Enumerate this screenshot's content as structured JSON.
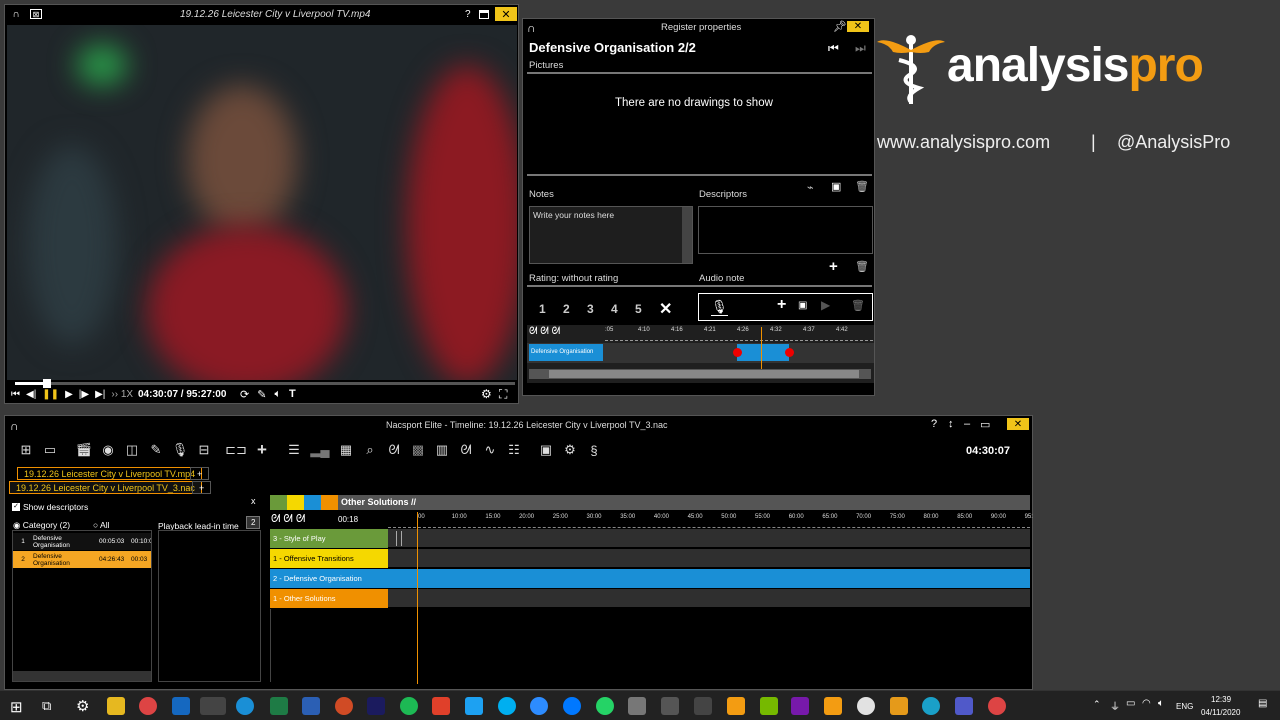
{
  "video_window": {
    "title": "19.12.26 Leicester City v Liverpool TV.mp4",
    "speed": "1X",
    "time": "04:30:07 / 95:27:00"
  },
  "register": {
    "window_title": "Register properties",
    "heading": "Defensive Organisation 2/2",
    "pictures_label": "Pictures",
    "no_drawings": "There are no drawings to show",
    "notes_label": "Notes",
    "notes_placeholder": "Write your notes here",
    "descriptors_label": "Descriptors",
    "rating_label": "Rating: without rating",
    "audio_label": "Audio note",
    "ratings": [
      "1",
      "2",
      "3",
      "4",
      "5"
    ],
    "mini_ticks": [
      ":05",
      "4:10",
      "4:16",
      "4:21",
      "4:26",
      "4:32",
      "4:37",
      "4:42"
    ],
    "mini_clip": "Defensive Organisation"
  },
  "brand": {
    "name_a": "analysis",
    "name_b": "pro",
    "website": "www.analysispro.com",
    "divider": "|",
    "handle": "@AnalysisPro",
    "accent": "#f39c12"
  },
  "timeline": {
    "title": "Nacsport Elite - Timeline: 19.12.26 Leicester City v Liverpool TV_3.nac",
    "clock": "04:30:07",
    "tab_video": "19.12.26 Leicester City v Liverpool TV.mp4",
    "tab_nac": "19.12.26 Leicester City v Liverpool TV_3.nac",
    "tab_add": "+",
    "close_x": "x",
    "show_descriptors": "Show descriptors",
    "category_label": "Category (2)",
    "all_label": "All",
    "playback_label": "Playback lead-in time",
    "playback_value": "2",
    "categories": [
      {
        "idx": "1",
        "name": "Defensive Organisation",
        "t1": "00:05:03",
        "t2": "00:10:0"
      },
      {
        "idx": "2",
        "name": "Defensive Organisation",
        "t1": "04:26:43",
        "t2": "00:03"
      }
    ],
    "header_label": "Other Solutions //",
    "zoom_time": "00:18",
    "ticks": [
      "00",
      "10:00",
      "15:00",
      "20:00",
      "25:00",
      "30:00",
      "35:00",
      "40:00",
      "45:00",
      "50:00",
      "55:00",
      "60:00",
      "65:00",
      "70:00",
      "75:00",
      "80:00",
      "85:00",
      "90:00",
      "95:"
    ],
    "rows": [
      {
        "label": "3 - Style of Play",
        "color": "#6a9a3a"
      },
      {
        "label": "1 - Offensive Transitions",
        "color": "#f5d800"
      },
      {
        "label": "2 - Defensive Organisation",
        "color": "#1a8fd6"
      },
      {
        "label": "1 - Other Solutions",
        "color": "#f09000"
      }
    ],
    "swatches": [
      "#6a9a3a",
      "#f5d800",
      "#1a8fd6",
      "#f09000"
    ]
  },
  "taskbar": {
    "lang": "ENG",
    "time": "12:39",
    "date": "04/11/2020"
  }
}
